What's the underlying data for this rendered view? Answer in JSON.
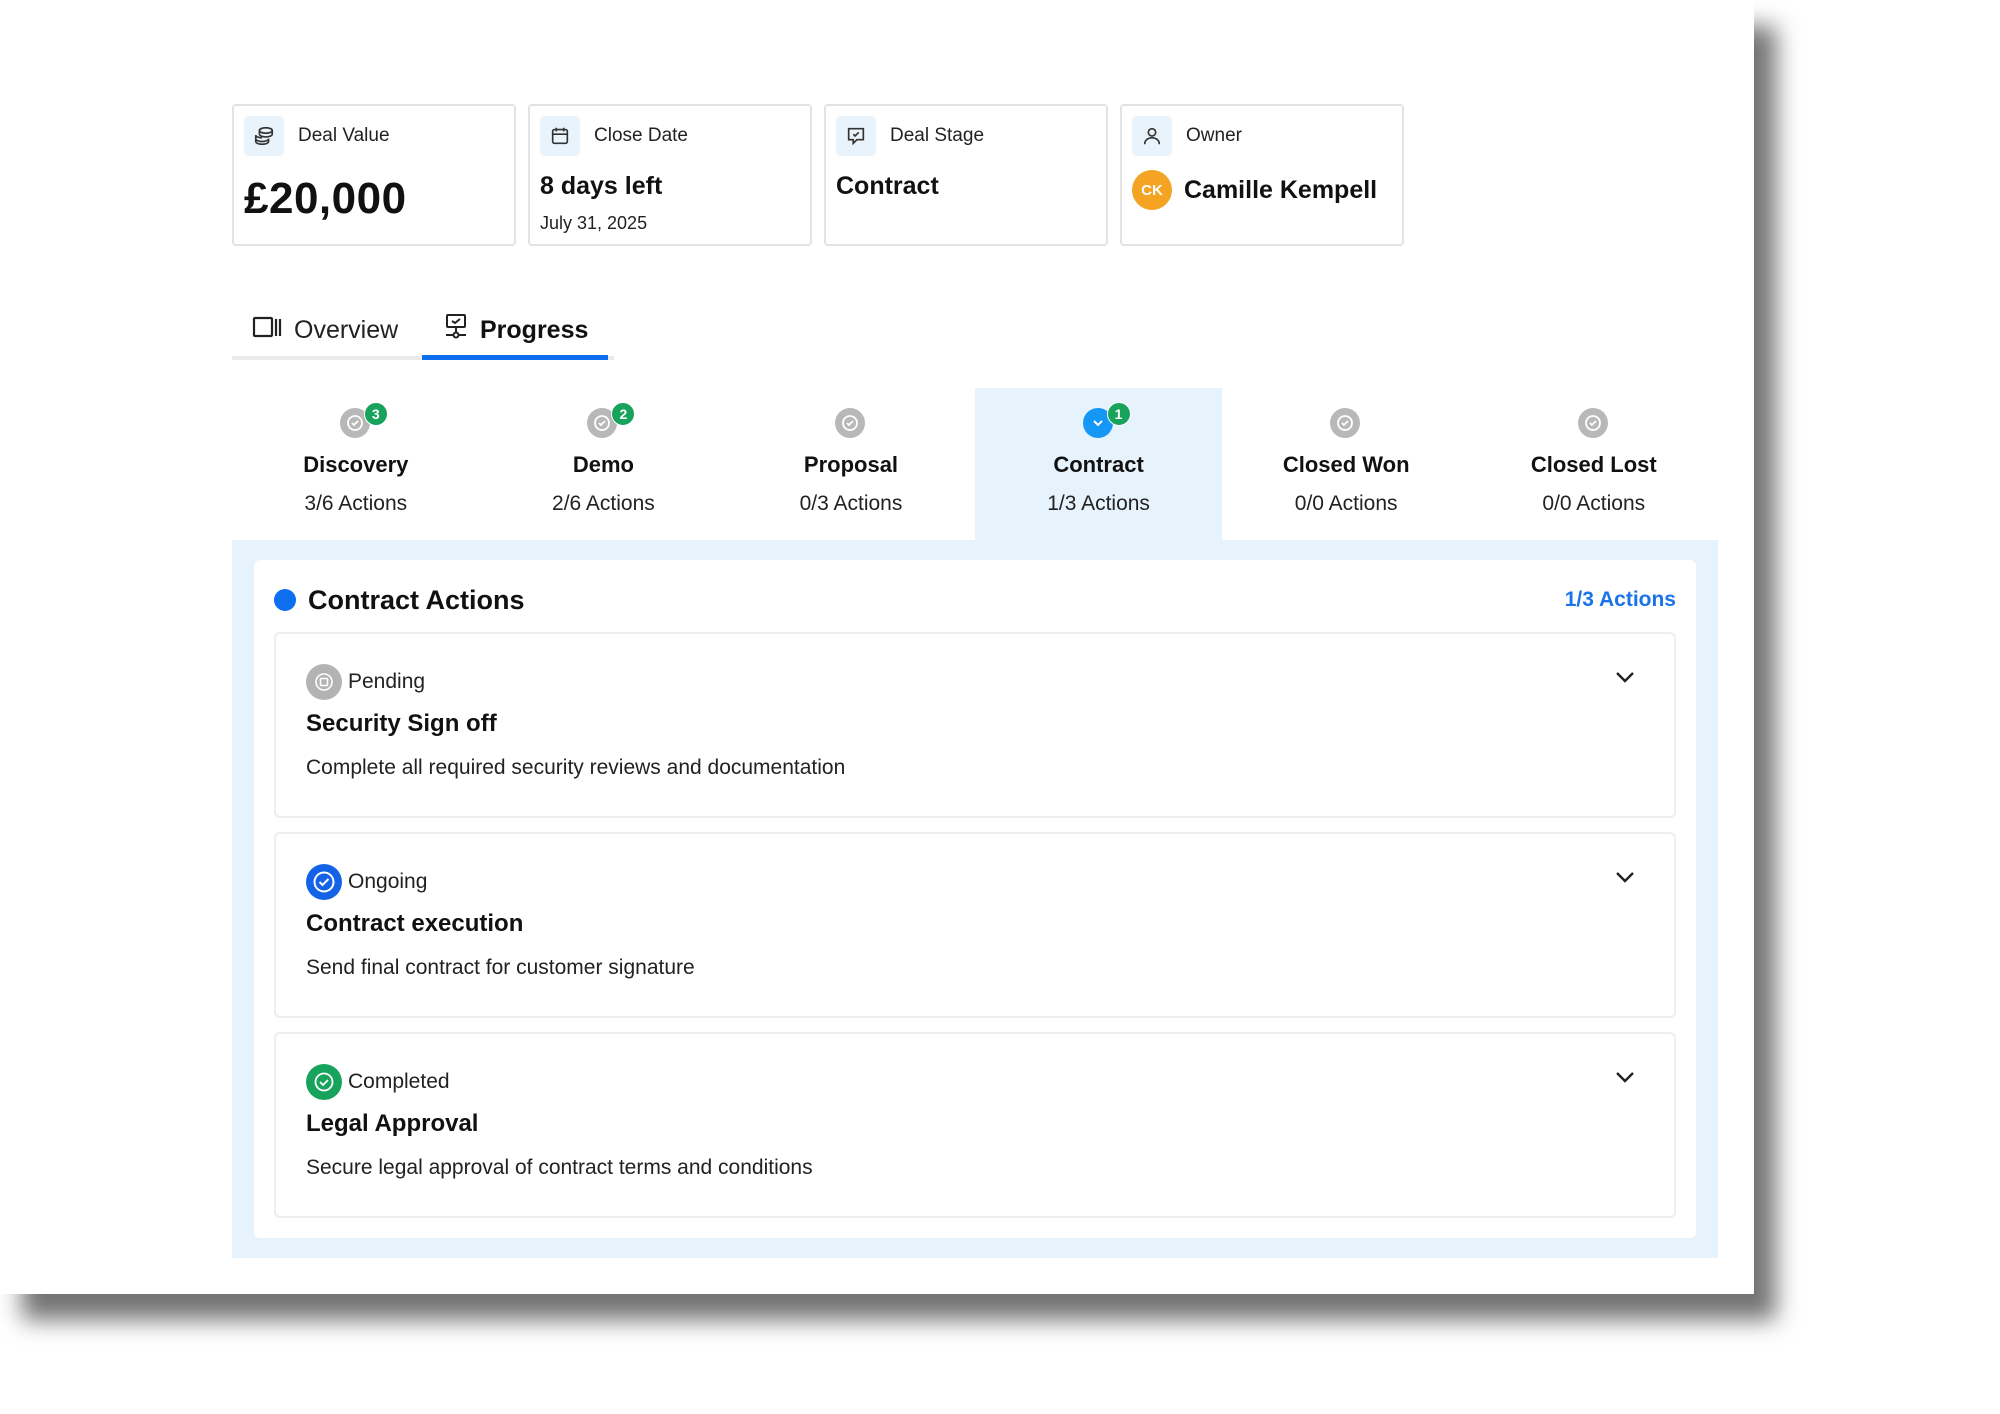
{
  "cards": [
    {
      "label": "Deal Value",
      "value": "£20,000",
      "icon": "coins-icon"
    },
    {
      "label": "Close Date",
      "value": "8 days left",
      "sub": "July 31, 2025",
      "icon": "calendar-icon"
    },
    {
      "label": "Deal Stage",
      "value": "Contract",
      "icon": "message-stage-icon"
    },
    {
      "label": "Owner",
      "value": "Camille Kempell",
      "initials": "CK",
      "icon": "user-icon"
    }
  ],
  "tabs": {
    "overview": "Overview",
    "progress": "Progress",
    "active": "Progress"
  },
  "stages": [
    {
      "name": "Discovery",
      "count": "3/6 Actions",
      "badge": "3"
    },
    {
      "name": "Demo",
      "count": "2/6 Actions",
      "badge": "2"
    },
    {
      "name": "Proposal",
      "count": "0/3 Actions",
      "badge": ""
    },
    {
      "name": "Contract",
      "count": "1/3 Actions",
      "badge": "1",
      "active": true
    },
    {
      "name": "Closed Won",
      "count": "0/0 Actions",
      "badge": ""
    },
    {
      "name": "Closed Lost",
      "count": "0/0 Actions",
      "badge": ""
    }
  ],
  "panel": {
    "title": "Contract Actions",
    "count": "1/3 Actions"
  },
  "actions": [
    {
      "status": "Pending",
      "title": "Security Sign off",
      "description": "Complete all required security reviews and documentation"
    },
    {
      "status": "Ongoing",
      "title": "Contract execution",
      "description": "Send final contract for customer signature"
    },
    {
      "status": "Completed",
      "title": "Legal Approval",
      "description": "Secure legal approval of contract terms and conditions"
    }
  ],
  "colors": {
    "accent": "#0d6ef0",
    "active_stage_bg": "#e6f2fc",
    "badge_green": "#17a35c",
    "avatar": "#f4a422"
  }
}
